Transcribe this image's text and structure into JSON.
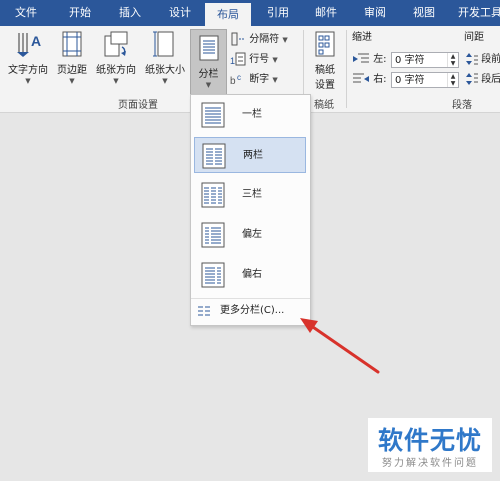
{
  "tabs": [
    "文件",
    "开始",
    "插入",
    "设计",
    "布局",
    "引用",
    "邮件",
    "审阅",
    "视图",
    "开发工具"
  ],
  "active_tab": "布局",
  "page_setup": {
    "text_direction": "文字方向",
    "margins": "页边距",
    "orientation": "纸张方向",
    "size": "纸张大小",
    "columns": "分栏",
    "breaks": "分隔符",
    "line_numbers": "行号",
    "hyphenation": "断字",
    "group_label": "页面设置"
  },
  "draft": {
    "button_line1": "稿纸",
    "button_line2": "设置",
    "group_label": "稿纸"
  },
  "paragraph": {
    "indent_label": "缩进",
    "left_label": "左:",
    "left_value": "0 字符",
    "right_label": "右:",
    "right_value": "0 字符",
    "spacing_label": "间距",
    "before_label": "段前",
    "after_label": "段后",
    "group_label": "段落"
  },
  "columns_menu": {
    "items": [
      "一栏",
      "两栏",
      "三栏",
      "偏左",
      "偏右"
    ],
    "selected": "两栏",
    "more": "更多分栏(C)..."
  },
  "watermark": {
    "title": "软件无忧",
    "subtitle": "努力解决软件问题"
  },
  "colors": {
    "tab_bar": "#2b579a",
    "ribbon": "#f3f3f3",
    "canvas": "#e6e6e6",
    "selection": "#d5e1f2",
    "annotation_arrow": "#d8322b",
    "watermark_blue": "#2f78c9"
  },
  "icons": [
    "text-direction-icon",
    "margins-icon",
    "orientation-icon",
    "size-icon",
    "columns-icon",
    "breaks-icon",
    "line-numbers-icon",
    "hyphenation-icon",
    "draft-paper-icon",
    "indent-left-icon",
    "indent-right-icon",
    "spacing-before-icon",
    "spacing-after-icon",
    "more-columns-icon",
    "arrow-annotation-icon"
  ]
}
